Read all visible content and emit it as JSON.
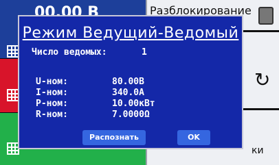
{
  "background": {
    "top_value": "00.00 В",
    "top_right_label": "Разблокирование",
    "bottom_right_label": "ки"
  },
  "dialog": {
    "title": "Режим Ведущий-Ведомый",
    "slaves_label": "Число ведомых:",
    "slaves_value": "1",
    "params": [
      {
        "label": "U-ном:",
        "value": "80.00В"
      },
      {
        "label": "I-ном:",
        "value": "340.0A"
      },
      {
        "label": "P-ном:",
        "value": "10.00кВт"
      },
      {
        "label": "R-ном:",
        "value": "7.0000Ω"
      }
    ],
    "detect_button": "Распознать",
    "ok_button": "OK"
  },
  "colors": {
    "dialog_bg": "#1428a8",
    "button": "#3566e0",
    "panel_blue": "#1d3f9a",
    "panel_red": "#d8142a",
    "panel_green": "#22b04a"
  }
}
